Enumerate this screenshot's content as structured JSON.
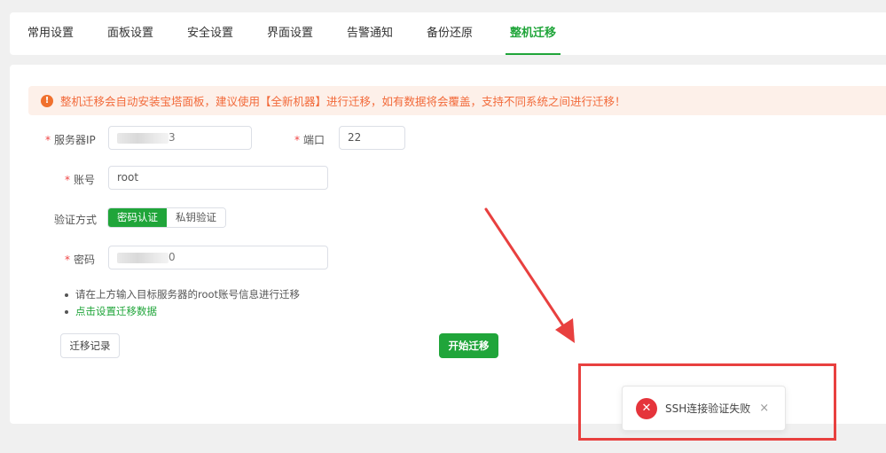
{
  "tabs": [
    {
      "label": "常用设置"
    },
    {
      "label": "面板设置"
    },
    {
      "label": "安全设置"
    },
    {
      "label": "界面设置"
    },
    {
      "label": "告警通知"
    },
    {
      "label": "备份还原"
    },
    {
      "label": "整机迁移",
      "active": true
    }
  ],
  "alert": {
    "icon": "exclamation-icon",
    "text": "整机迁移会自动安装宝塔面板，建议使用【全新机器】进行迁移，如有数据将会覆盖，支持不同系统之间进行迁移！"
  },
  "form": {
    "required_mark": "*",
    "server_ip_label": "服务器IP",
    "server_ip_value_tail": "3",
    "port_label": "端口",
    "port_value": "22",
    "account_label": "账号",
    "account_value": "root",
    "auth_method_label": "验证方式",
    "auth_options": [
      "密码认证",
      "私钥验证"
    ],
    "auth_selected": "密码认证",
    "password_label": "密码",
    "password_value_tail": "0"
  },
  "notes": [
    "请在上方输入目标服务器的root账号信息进行迁移",
    "点击设置迁移数据"
  ],
  "buttons": {
    "records": "迁移记录",
    "start": "开始迁移"
  },
  "toast": {
    "icon": "error-x-icon",
    "message": "SSH连接验证失败",
    "close": "×"
  },
  "colors": {
    "accent": "#20a53a",
    "warning_text": "#f26a3a",
    "warning_bg": "#fdf0e9",
    "error": "#e5343b",
    "annotation_red": "#e8403f"
  }
}
